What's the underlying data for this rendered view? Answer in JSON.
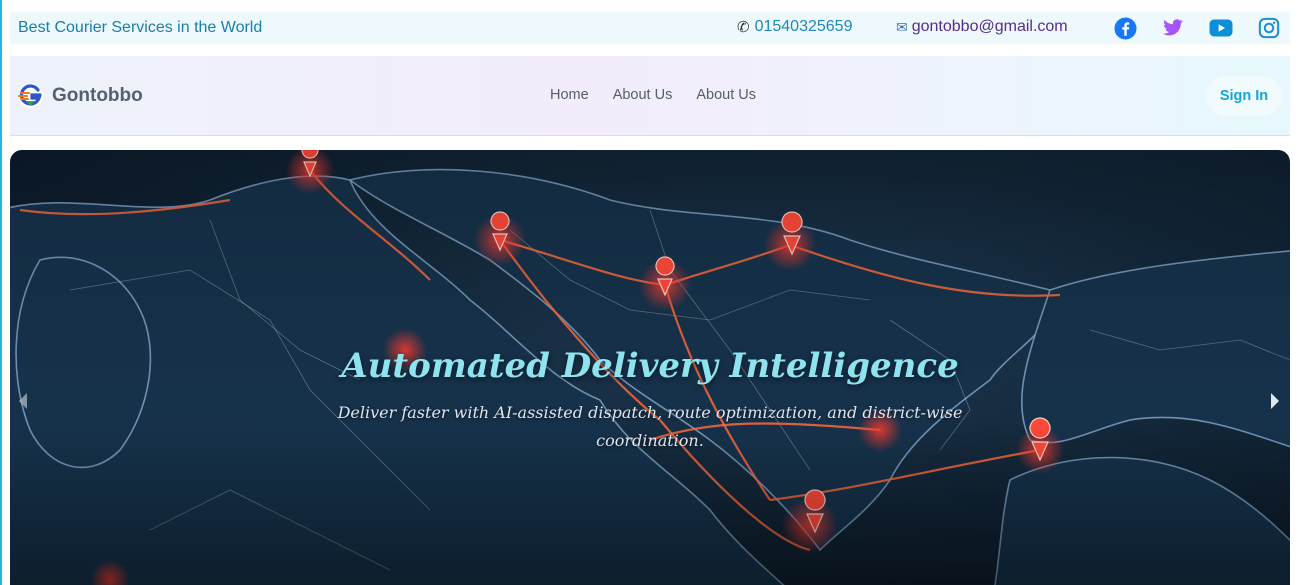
{
  "topbar": {
    "tagline": "Best Courier Services in the World",
    "phone": "01540325659",
    "phone_icon": "phone-icon",
    "email": "gontobbo@gmail.com",
    "email_icon": "envelope-icon",
    "socials": [
      "facebook-icon",
      "twitter-icon",
      "youtube-icon",
      "instagram-icon"
    ]
  },
  "navbar": {
    "brand": "Gontobbo",
    "links": [
      "Home",
      "About Us",
      "About Us"
    ],
    "signin": "Sign In"
  },
  "hero": {
    "title": "Automated Delivery Intelligence",
    "subtitle": "Deliver faster with AI-assisted dispatch, route optimization, and district-wise coordination.",
    "prev_icon": "chevron-left-icon",
    "next_icon": "chevron-right-icon"
  },
  "colors": {
    "accent": "#14a7d6",
    "facebook": "#1877f2",
    "twitter": "#a855f7",
    "youtube": "#0a8fd8",
    "instagram": "#1c8fd0",
    "pin": "#ff3b30",
    "title": "#8fe3ef"
  }
}
